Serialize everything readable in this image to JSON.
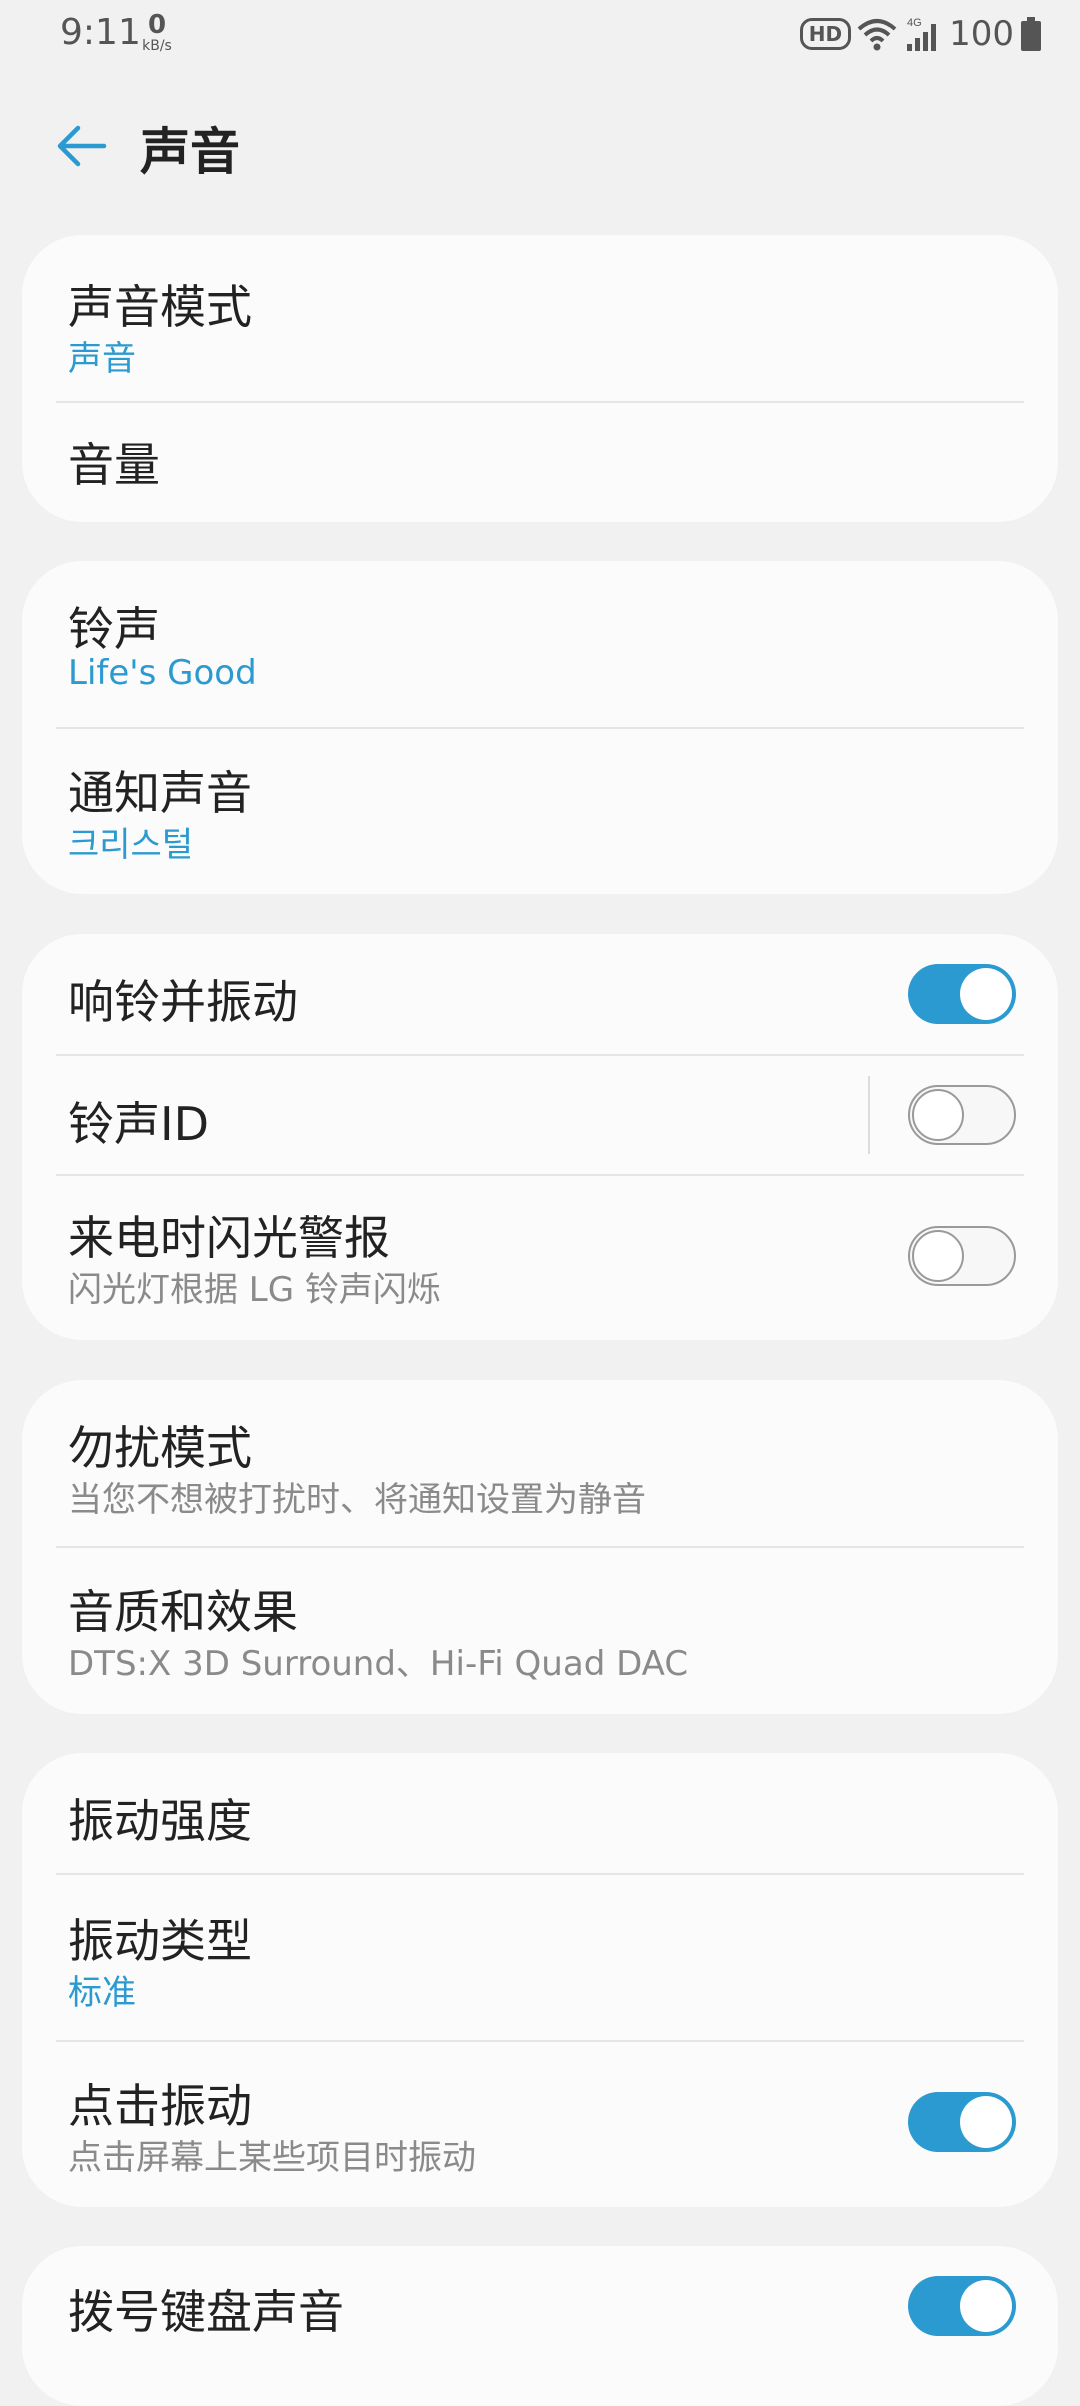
{
  "status_bar": {
    "time": "9:11",
    "net_speed": "0",
    "net_unit": "kB/s",
    "hd_badge": "HD",
    "network_type": "4G",
    "battery_level": "100",
    "icons": [
      "wifi-icon",
      "cellular-signal-icon",
      "battery-icon"
    ]
  },
  "header": {
    "back_icon": "back-arrow-icon",
    "title": "声音"
  },
  "cards": {
    "mode": {
      "sound_mode_title": "声音模式",
      "sound_mode_value": "声音",
      "volume_title": "音量"
    },
    "tones": {
      "ringtone_title": "铃声",
      "ringtone_value": "Life's Good",
      "notification_title": "通知声音",
      "notification_value": "크리스털"
    },
    "ring": {
      "ring_vibrate_title": "响铃并振动",
      "ring_vibrate_on": true,
      "ringtone_id_title": "铃声ID",
      "ringtone_id_on": false,
      "flash_alert_title": "来电时闪光警报",
      "flash_alert_desc": "闪光灯根据 LG 铃声闪烁",
      "flash_alert_on": false
    },
    "dnd": {
      "dnd_title": "勿扰模式",
      "dnd_desc": "当您不想被打扰时、将通知设置为静音",
      "quality_title": "音质和效果",
      "quality_desc": "DTS:X 3D Surround、Hi-Fi Quad DAC"
    },
    "vibration": {
      "strength_title": "振动强度",
      "type_title": "振动类型",
      "type_value": "标准",
      "tap_title": "点击振动",
      "tap_desc": "点击屏幕上某些项目时振动",
      "tap_on": true
    },
    "dialpad": {
      "dialpad_title": "拨号键盘声音",
      "dialpad_on": true
    }
  },
  "colors": {
    "accent": "#2a9ad0",
    "background": "#f1f1f1",
    "card": "#fbfbfb"
  }
}
